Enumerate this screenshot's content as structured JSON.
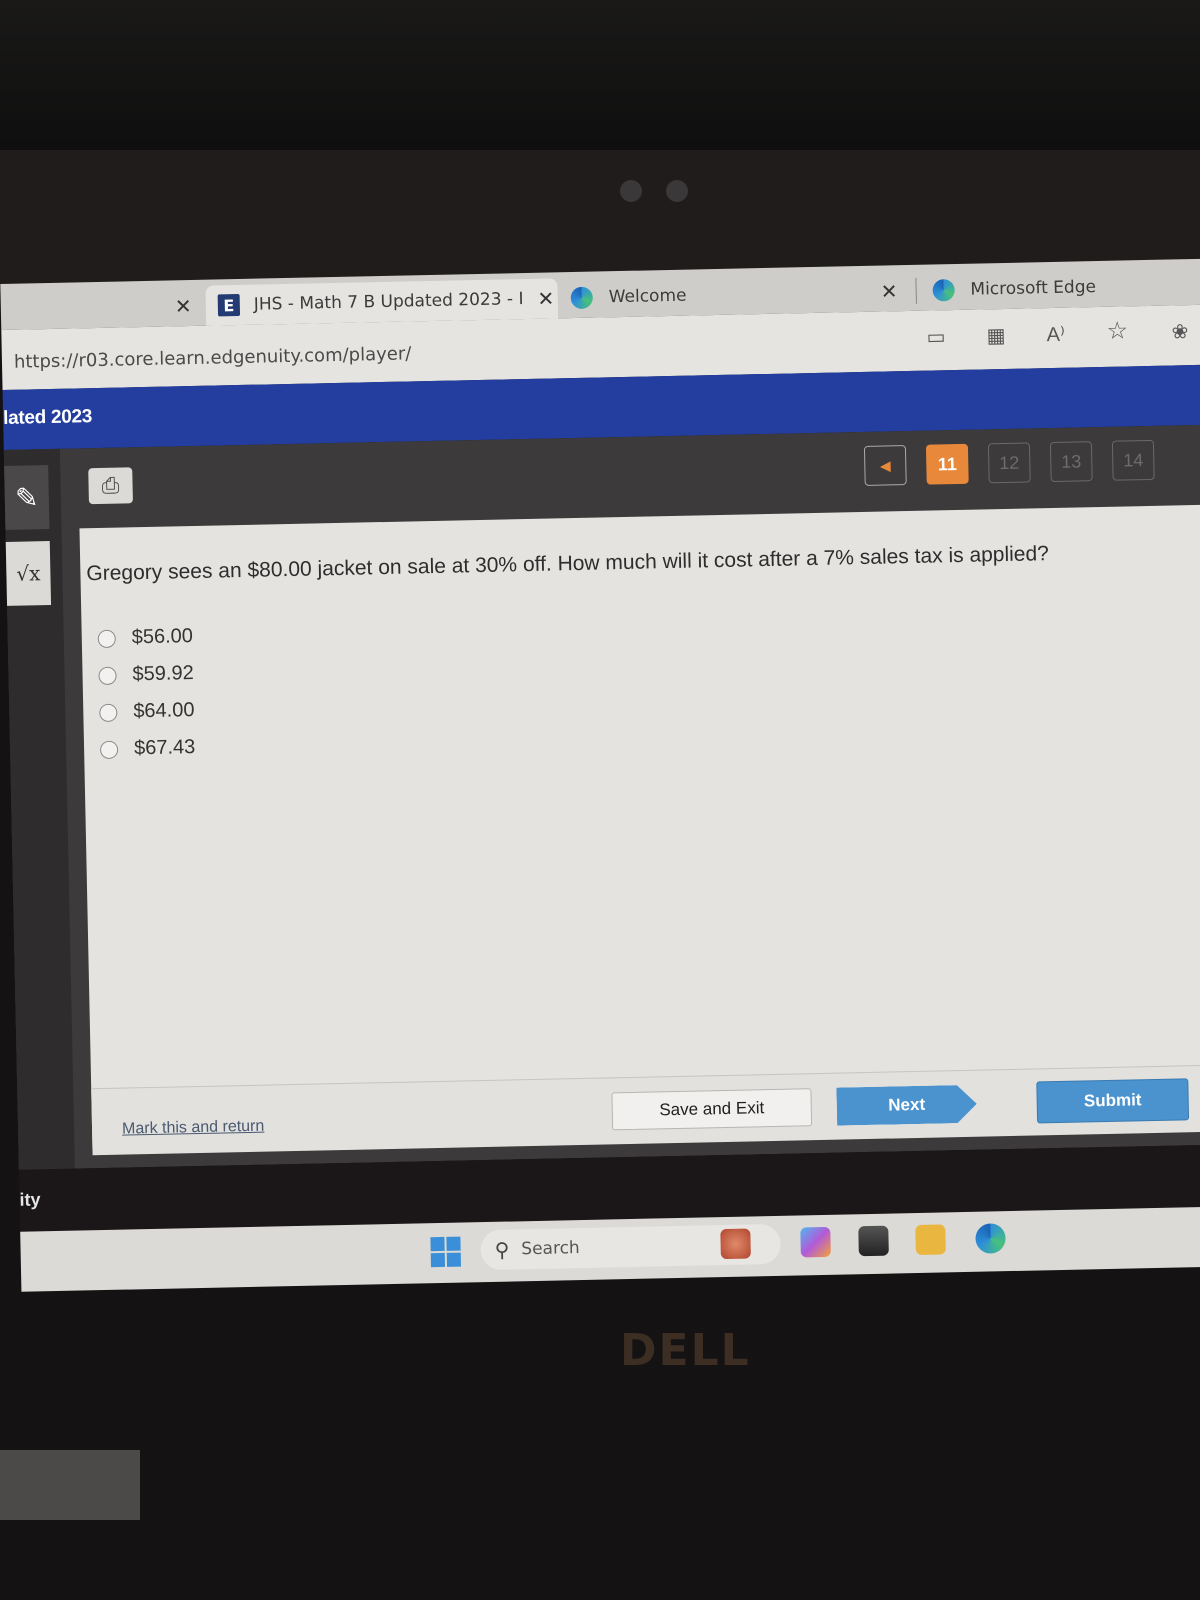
{
  "browser": {
    "tabs": [
      {
        "label": "",
        "close": "✕"
      },
      {
        "label": "JHS - Math 7 B Updated 2023 - I",
        "close": "✕",
        "favicon": "edgenuity-e-icon"
      },
      {
        "label": "Welcome",
        "favicon": "edge-icon"
      },
      {
        "label": "Microsoft Edge",
        "close": "✕",
        "favicon": "edge-icon"
      }
    ],
    "url": "https://r03.core.learn.edgenuity.com/player/",
    "toolbar_icons": [
      "device-icon",
      "apps-grid-icon",
      "read-aloud-icon",
      "favorite-star-icon",
      "extensions-icon"
    ],
    "read_aloud_glyph": "A⁾",
    "star_glyph": "☆"
  },
  "app": {
    "course_title": "lated 2023",
    "pager": {
      "prev_glyph": "◀",
      "pages": [
        "11",
        "12",
        "13",
        "14"
      ],
      "current": "11"
    },
    "accent_color": "#e8883a",
    "header_color": "#243ea0"
  },
  "question": {
    "text": "Gregory sees an $80.00 jacket on sale at 30% off. How much will it cost after a 7% sales tax is applied?",
    "choices": [
      "$56.00",
      "$59.92",
      "$64.00",
      "$67.43"
    ]
  },
  "footer": {
    "mark_link": "Mark this and return",
    "save_exit": "Save and Exit",
    "next": "Next",
    "submit": "Submit"
  },
  "dark_strip_text": "ity",
  "taskbar": {
    "search_label": "Search"
  },
  "hardware": {
    "brand": "DELL"
  }
}
